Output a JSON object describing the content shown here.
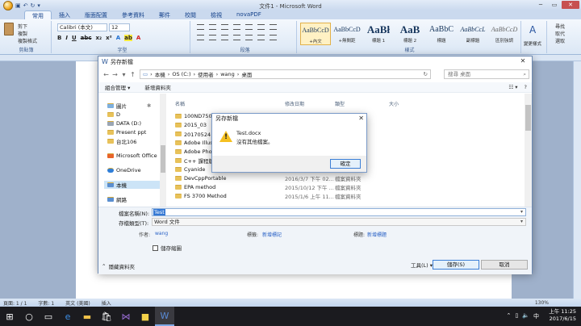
{
  "window": {
    "title": "文件1 - Microsoft Word"
  },
  "ribbon": {
    "tabs": [
      "常用",
      "插入",
      "版面配置",
      "參考資料",
      "郵件",
      "校閱",
      "檢視",
      "novaPDF"
    ],
    "clipboard": {
      "label": "剪貼簿",
      "cut": "剪下",
      "copy": "複製",
      "format_painter": "複製格式"
    },
    "font": {
      "name": "Calibri (本文)",
      "size": "12",
      "label": "字型"
    },
    "paragraph": {
      "label": "段落"
    },
    "styles": {
      "label": "樣式",
      "items": [
        {
          "sample": "AaBbCcD",
          "name": "+內文"
        },
        {
          "sample": "AaBbCcD",
          "name": "+無間距"
        },
        {
          "sample": "AaBł",
          "name": "標題 1"
        },
        {
          "sample": "AaB",
          "name": "標題 2"
        },
        {
          "sample": "AaBbC",
          "name": "標題"
        },
        {
          "sample": "AaBbCcL",
          "name": "副標題"
        },
        {
          "sample": "AaBbCcD",
          "name": "區別強調"
        }
      ],
      "change": "變更樣式"
    },
    "editing": {
      "find": "尋找",
      "replace": "取代",
      "select": "選取"
    }
  },
  "statusbar": {
    "page": "頁面: 1 / 1",
    "words": "字數: 1",
    "lang": "英文 (美國)",
    "mode": "插入",
    "zoom": "130%"
  },
  "taskbar": {
    "time": "上午 11:25",
    "date": "2017/6/15"
  },
  "save_dialog": {
    "title": "另存新檔",
    "path": [
      "本機",
      "OS (C:)",
      "使用者",
      "wang",
      "桌面"
    ],
    "search_placeholder": "搜尋 桌面",
    "toolbar": {
      "organize": "組合管理 ▾",
      "new_folder": "新增資料夾"
    },
    "nav": [
      {
        "label": "圖片",
        "icon": "pictures-icon"
      },
      {
        "label": "D",
        "icon": "folder-icon"
      },
      {
        "label": "DATA (D:)",
        "icon": "drive-icon"
      },
      {
        "label": "Present ppt",
        "icon": "folder-icon"
      },
      {
        "label": "台北106",
        "icon": "folder-icon"
      },
      {
        "label": "Microsoft Office",
        "icon": "office-icon"
      },
      {
        "label": "OneDrive",
        "icon": "onedrive-icon"
      },
      {
        "label": "本機",
        "icon": "computer-icon"
      },
      {
        "label": "網路",
        "icon": "network-icon"
      }
    ],
    "columns": {
      "name": "名稱",
      "date": "修改日期",
      "type": "類型",
      "size": "大小"
    },
    "files": [
      {
        "name": "100ND750",
        "date": "",
        "type": ""
      },
      {
        "name": "2015_03",
        "date": "",
        "type": ""
      },
      {
        "name": "20170524 使",
        "date": "",
        "type": ""
      },
      {
        "name": "Adobe Illustr",
        "date": "",
        "type": ""
      },
      {
        "name": "Adobe Photo",
        "date": "",
        "type": ""
      },
      {
        "name": "C++ 課程版",
        "date": "",
        "type": ""
      },
      {
        "name": "Cyanide",
        "date": "",
        "type": ""
      },
      {
        "name": "DevCppPortable",
        "date": "2016/3/7 下午 02...",
        "type": "檔案資料夾"
      },
      {
        "name": "EPA method",
        "date": "2015/10/12 下午 ...",
        "type": "檔案資料夾"
      },
      {
        "name": "FS 3700 Method",
        "date": "2015/1/6 上午 11...",
        "type": "檔案資料夾"
      }
    ],
    "filename_label": "檔案名稱(N):",
    "filename_value": "Test",
    "filetype_label": "存檔類型(T):",
    "filetype_value": "Word 文件",
    "author_label": "作者:",
    "author_value": "wang",
    "tags_label": "標籤:",
    "tags_value": "新增標記",
    "title_label": "標題:",
    "title_value": "新增標題",
    "thumbnail": "儲存縮圖",
    "hide_folders": "隱藏資料夾",
    "tools": "工具(L) ▾",
    "save": "儲存(S)",
    "cancel": "取消"
  },
  "message_box": {
    "title": "另存新檔",
    "line1": "Test.docx",
    "line2": "沒有其他檔案。",
    "ok": "確定"
  }
}
